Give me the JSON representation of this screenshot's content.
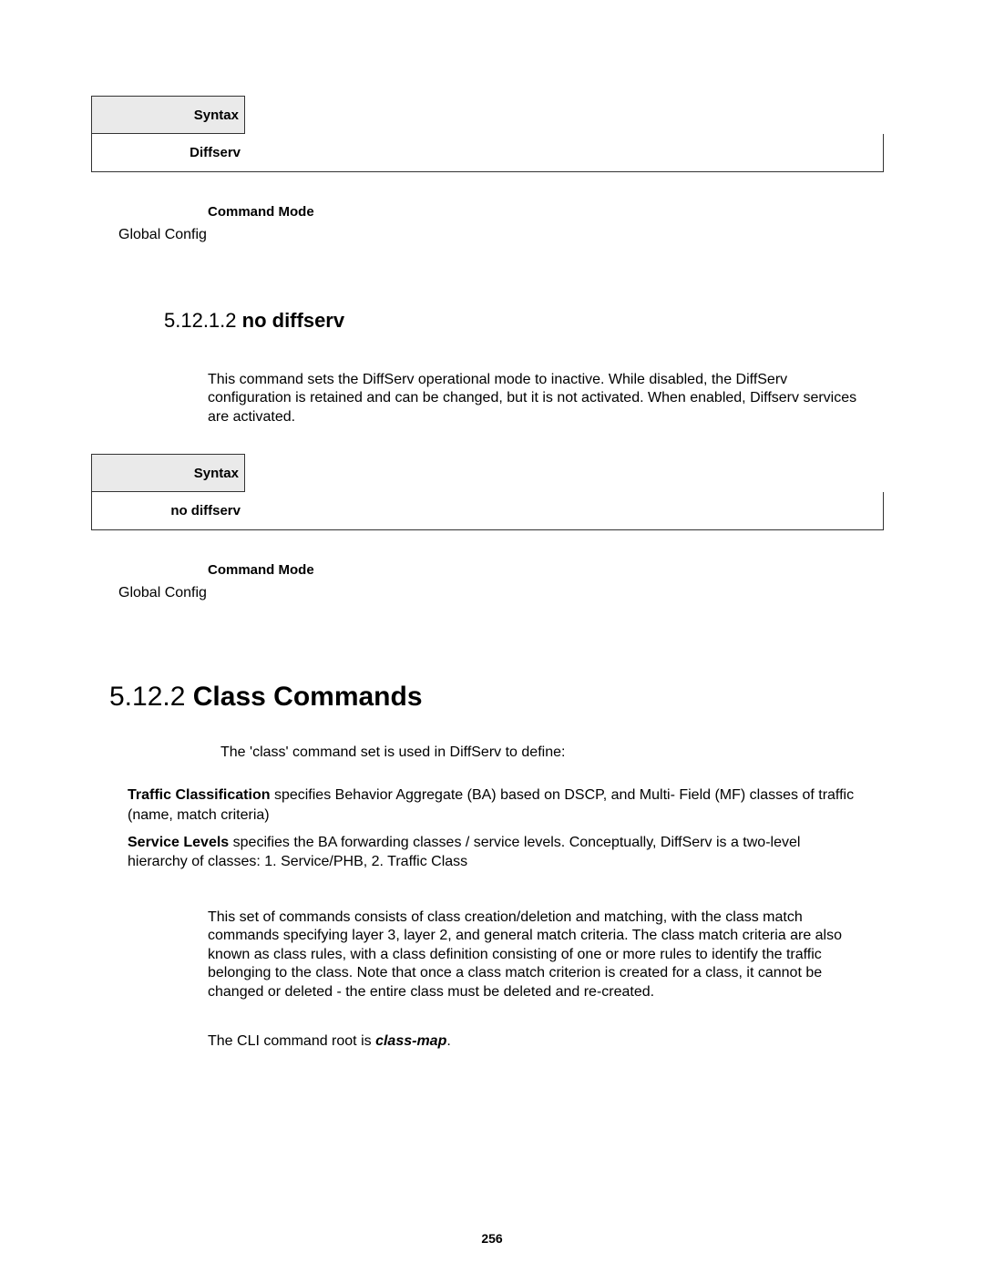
{
  "syntax1": {
    "header": "Syntax",
    "value": "Diffserv"
  },
  "cmdmode1": {
    "label": "Command Mode",
    "value": "Global Config"
  },
  "section_no_diffserv": {
    "number": "5.12.1.2",
    "title": "no diffserv",
    "body": "This command sets the DiffServ operational mode to inactive. While disabled, the DiffServ configuration is retained and can be changed, but it is not activated. When enabled, Diffserv services are activated."
  },
  "syntax2": {
    "header": "Syntax",
    "value": "no diffserv"
  },
  "cmdmode2": {
    "label": "Command Mode",
    "value": "Global Config"
  },
  "section_class_commands": {
    "number": "5.12.2",
    "title": "Class Commands",
    "intro": "The 'class' command set is used in DiffServ to define:",
    "def1_term": "Traffic Classification",
    "def1_body": " specifies Behavior Aggregate (BA) based on DSCP, and Multi- Field (MF) classes of traffic (name, match criteria)",
    "def2_term": "Service Levels",
    "def2_body": " specifies the BA forwarding classes / service levels. Conceptually, DiffServ is a two-level hierarchy of classes: 1. Service/PHB, 2. Traffic Class",
    "long_body": "This set of commands consists of class creation/deletion and matching, with the class match commands specifying layer 3, layer 2, and general match criteria. The class match criteria are also known as class rules, with a class definition consisting of one or more rules to identify the traffic belonging to the class. Note that once a class match criterion is created for a class, it cannot be changed or deleted - the entire class must be deleted and re-created.",
    "cli_prefix": "The CLI command root is ",
    "cli_root": "class-map",
    "cli_suffix": "."
  },
  "page_number": "256"
}
